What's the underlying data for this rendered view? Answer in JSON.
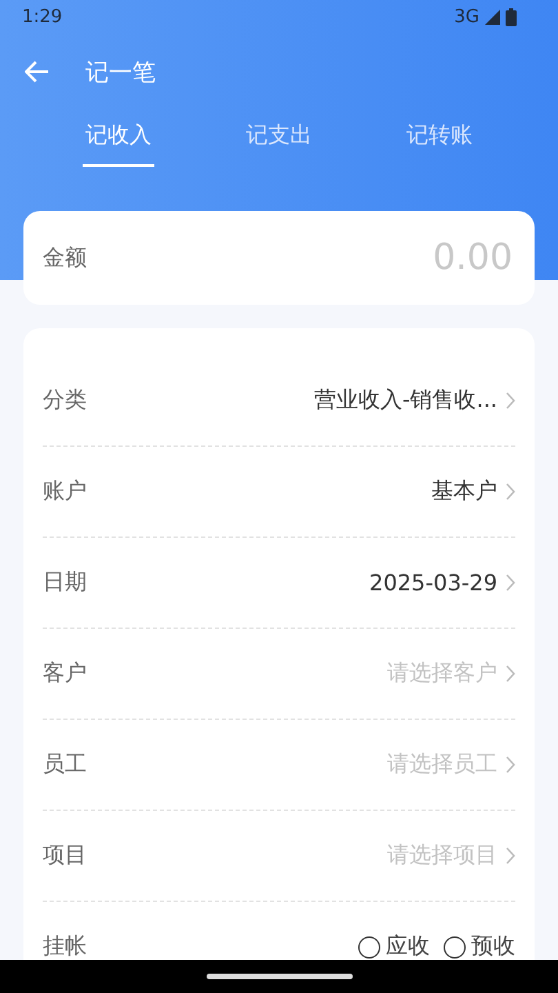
{
  "status_bar": {
    "time": "1:29",
    "network": "3G"
  },
  "header": {
    "title": "记一笔"
  },
  "tabs": [
    {
      "label": "记收入",
      "selected": true
    },
    {
      "label": "记支出",
      "selected": false
    },
    {
      "label": "记转账",
      "selected": false
    }
  ],
  "amount": {
    "label": "金额",
    "placeholder": "0.00"
  },
  "form_rows": [
    {
      "kind": "select",
      "label": "分类",
      "value": "营业收入-销售收..."
    },
    {
      "kind": "select",
      "label": "账户",
      "value": "基本户"
    },
    {
      "kind": "select",
      "label": "日期",
      "value": "2025-03-29"
    },
    {
      "kind": "select",
      "label": "客户",
      "placeholder": "请选择客户"
    },
    {
      "kind": "select",
      "label": "员工",
      "placeholder": "请选择员工"
    },
    {
      "kind": "select",
      "label": "项目",
      "placeholder": "请选择项目"
    },
    {
      "kind": "radio",
      "label": "挂帐",
      "options": [
        {
          "label": "应收",
          "selected": false
        },
        {
          "label": "预收",
          "selected": false
        }
      ]
    }
  ]
}
